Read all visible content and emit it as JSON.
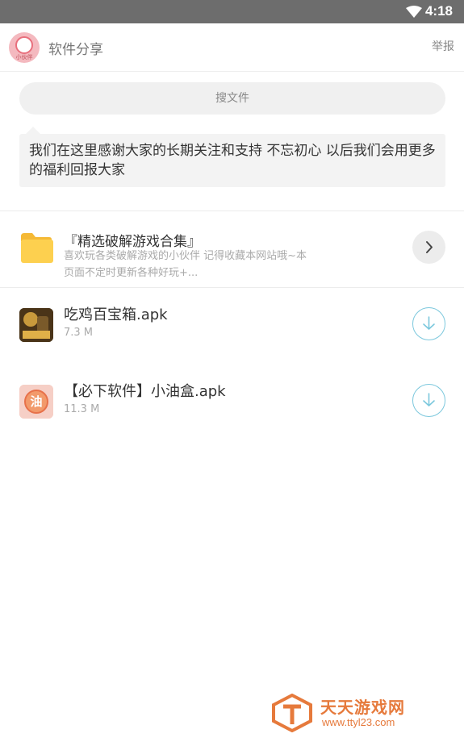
{
  "status_bar": {
    "time": "4:18"
  },
  "header": {
    "title": "软件分享",
    "report": "举报",
    "avatar_text": "小伙伴"
  },
  "search": {
    "placeholder": "搜文件"
  },
  "notice": {
    "text": "我们在这里感谢大家的长期关注和支持 不忘初心 以后我们会用更多的福利回报大家"
  },
  "folder": {
    "title": "『精选破解游戏合集』",
    "description": "喜欢玩各类破解游戏的小伙伴 记得收藏本网站哦~本页面不定时更新各种好玩+..."
  },
  "files": [
    {
      "name": "吃鸡百宝箱.apk",
      "size": "7.3 M"
    },
    {
      "name": "【必下软件】小油盒.apk",
      "size": "11.3 M",
      "icon_text": "油"
    }
  ],
  "watermark": {
    "name": "天天游戏网",
    "url": "www.ttyl23.com"
  },
  "colors": {
    "accent": "#7cc8dd",
    "folder": "#fdd04f",
    "watermark": "#e67a3c"
  }
}
